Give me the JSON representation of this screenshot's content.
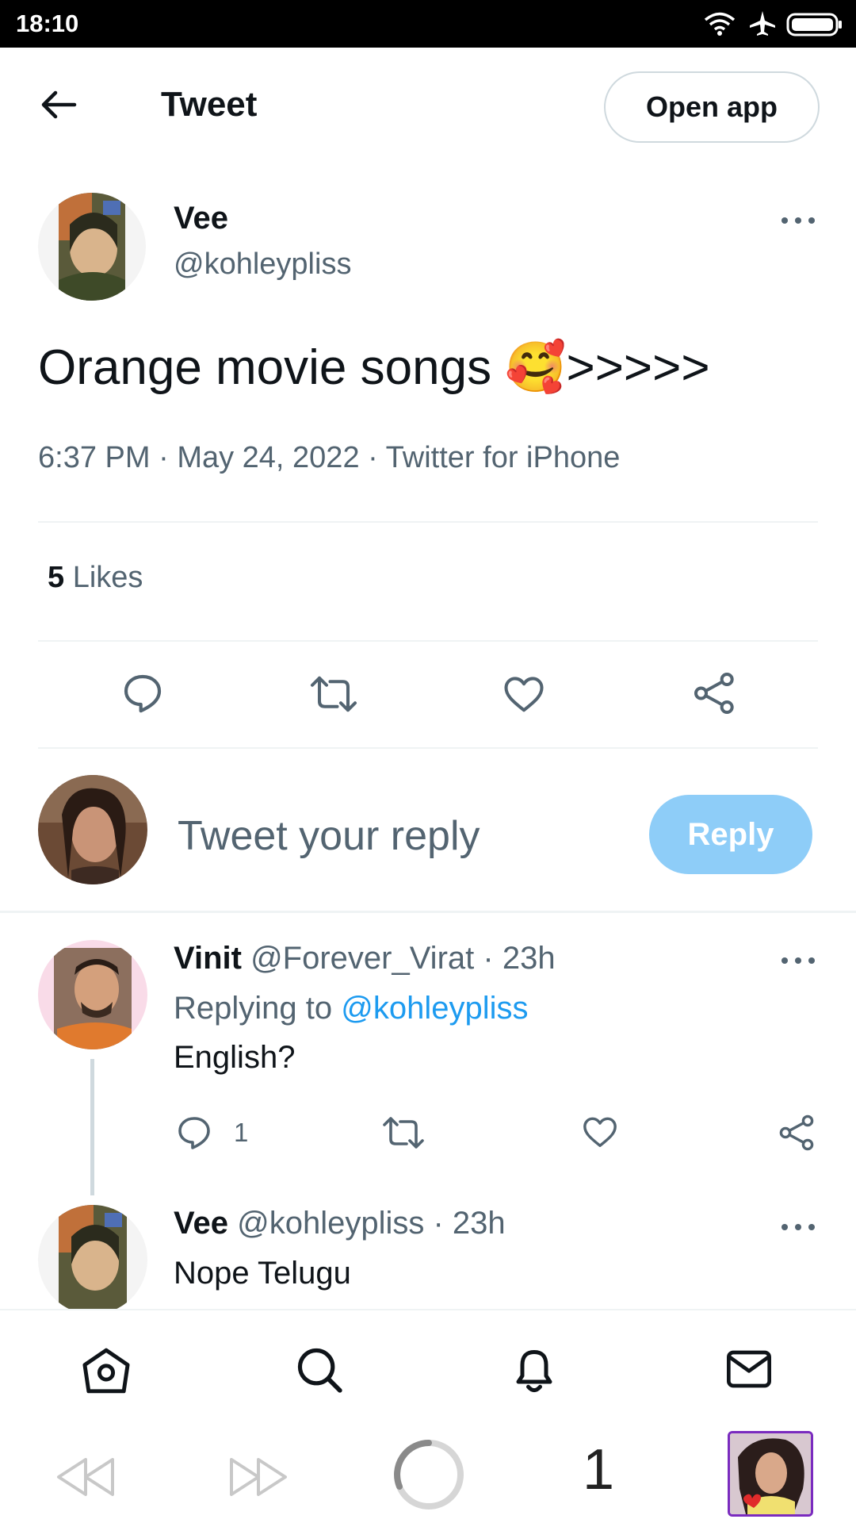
{
  "status_bar": {
    "time": "18:10",
    "icons": [
      "wifi-icon",
      "airplane-icon",
      "battery-icon"
    ]
  },
  "header": {
    "title": "Tweet",
    "open_app_label": "Open app",
    "back_icon": "back-arrow-icon"
  },
  "tweet": {
    "author_name": "Vee",
    "author_handle": "@kohleypliss",
    "text": "Orange movie songs",
    "emoji": "🥰",
    "text_suffix": ">>>>>",
    "time": "6:37 PM",
    "date": "May 24, 2022",
    "source": "Twitter for iPhone",
    "likes_count": "5",
    "likes_label": "Likes",
    "actions": [
      "reply-icon",
      "retweet-icon",
      "like-icon",
      "share-icon"
    ]
  },
  "composer": {
    "placeholder": "Tweet your reply",
    "reply_label": "Reply"
  },
  "replies": [
    {
      "name": "Vinit",
      "handle": "@Forever_Virat",
      "age": "23h",
      "replying_prefix": "Replying to",
      "replying_to": "@kohleypliss",
      "text": "English?",
      "reply_count": "1"
    },
    {
      "name": "Vee",
      "handle": "@kohleypliss",
      "age": "23h",
      "text": "Nope Telugu"
    }
  ],
  "separator": "·",
  "bottom_nav": [
    "home-icon",
    "search-icon",
    "notifications-icon",
    "messages-icon"
  ],
  "browser_bar": {
    "tab_count": "1",
    "items": [
      "back-icon",
      "forward-icon",
      "loading-icon",
      "tabs-count",
      "profile-thumbnail"
    ]
  },
  "colors": {
    "accent": "#1d9bf0",
    "reply_button": "#8ecdf8",
    "muted": "#536471"
  }
}
